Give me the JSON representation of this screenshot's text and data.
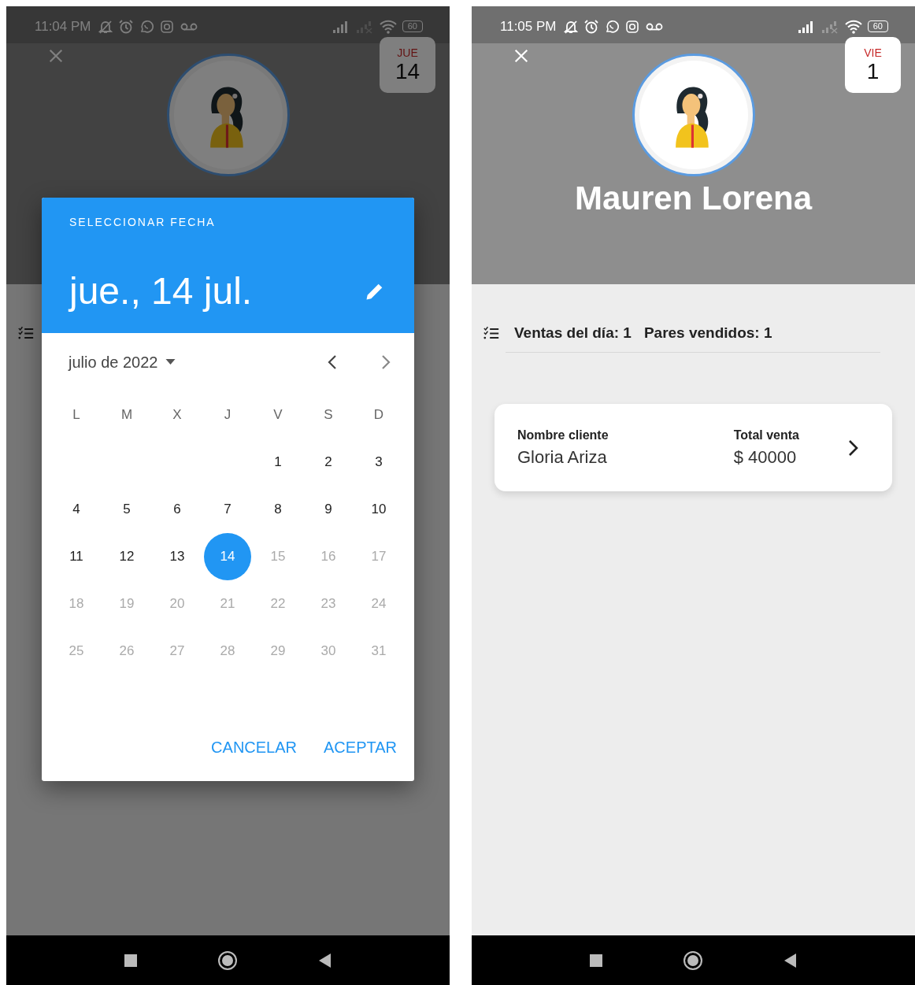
{
  "screens": [
    {
      "dimmed": true,
      "status_bar": {
        "time": "11:04 PM",
        "battery": "60"
      },
      "date_badge": {
        "weekday": "JUE",
        "day": "14"
      },
      "date_picker": {
        "title": "SELECCIONAR FECHA",
        "selected_date": "jue., 14 jul.",
        "month": "julio de 2022",
        "weekdays": [
          "L",
          "M",
          "X",
          "J",
          "V",
          "S",
          "D"
        ],
        "weeks": [
          [
            {
              "day": "1",
              "selected": false,
              "disabled": false
            },
            {
              "day": "2",
              "selected": false,
              "disabled": false
            },
            {
              "day": "3",
              "selected": false,
              "disabled": false
            }
          ],
          [
            {
              "day": "4",
              "selected": false,
              "disabled": false
            },
            {
              "day": "5",
              "selected": false,
              "disabled": false
            },
            {
              "day": "6",
              "selected": false,
              "disabled": false
            },
            {
              "day": "7",
              "selected": false,
              "disabled": false
            },
            {
              "day": "8",
              "selected": false,
              "disabled": false
            },
            {
              "day": "9",
              "selected": false,
              "disabled": false
            },
            {
              "day": "10",
              "selected": false,
              "disabled": false
            }
          ],
          [
            {
              "day": "11",
              "selected": false,
              "disabled": false
            },
            {
              "day": "12",
              "selected": false,
              "disabled": false
            },
            {
              "day": "13",
              "selected": false,
              "disabled": false
            },
            {
              "day": "14",
              "selected": true,
              "disabled": false
            },
            {
              "day": "15",
              "selected": false,
              "disabled": true
            },
            {
              "day": "16",
              "selected": false,
              "disabled": true
            },
            {
              "day": "17",
              "selected": false,
              "disabled": true
            }
          ],
          [
            {
              "day": "18",
              "selected": false,
              "disabled": true
            },
            {
              "day": "19",
              "selected": false,
              "disabled": true
            },
            {
              "day": "20",
              "selected": false,
              "disabled": true
            },
            {
              "day": "21",
              "selected": false,
              "disabled": true
            },
            {
              "day": "22",
              "selected": false,
              "disabled": true
            },
            {
              "day": "23",
              "selected": false,
              "disabled": true
            },
            {
              "day": "24",
              "selected": false,
              "disabled": true
            }
          ],
          [
            {
              "day": "25",
              "selected": false,
              "disabled": true
            },
            {
              "day": "26",
              "selected": false,
              "disabled": true
            },
            {
              "day": "27",
              "selected": false,
              "disabled": true
            },
            {
              "day": "28",
              "selected": false,
              "disabled": true
            },
            {
              "day": "29",
              "selected": false,
              "disabled": true
            },
            {
              "day": "30",
              "selected": false,
              "disabled": true
            },
            {
              "day": "31",
              "selected": false,
              "disabled": true
            }
          ]
        ],
        "buttons": [
          "CANCELAR",
          "ACEPTAR"
        ]
      }
    },
    {
      "dimmed": false,
      "status_bar": {
        "time": "11:05 PM",
        "battery": "60"
      },
      "date_badge": {
        "weekday": "VIE",
        "day": "1"
      },
      "profile_name": "Mauren Lorena",
      "summary": {
        "sales": "Ventas del día: 1",
        "pairs": "Pares vendidos: 1"
      },
      "sales": [
        {
          "client_label": "Nombre cliente",
          "client": "Gloria Ariza",
          "total_label": "Total venta",
          "total": "$ 40000"
        }
      ]
    }
  ]
}
